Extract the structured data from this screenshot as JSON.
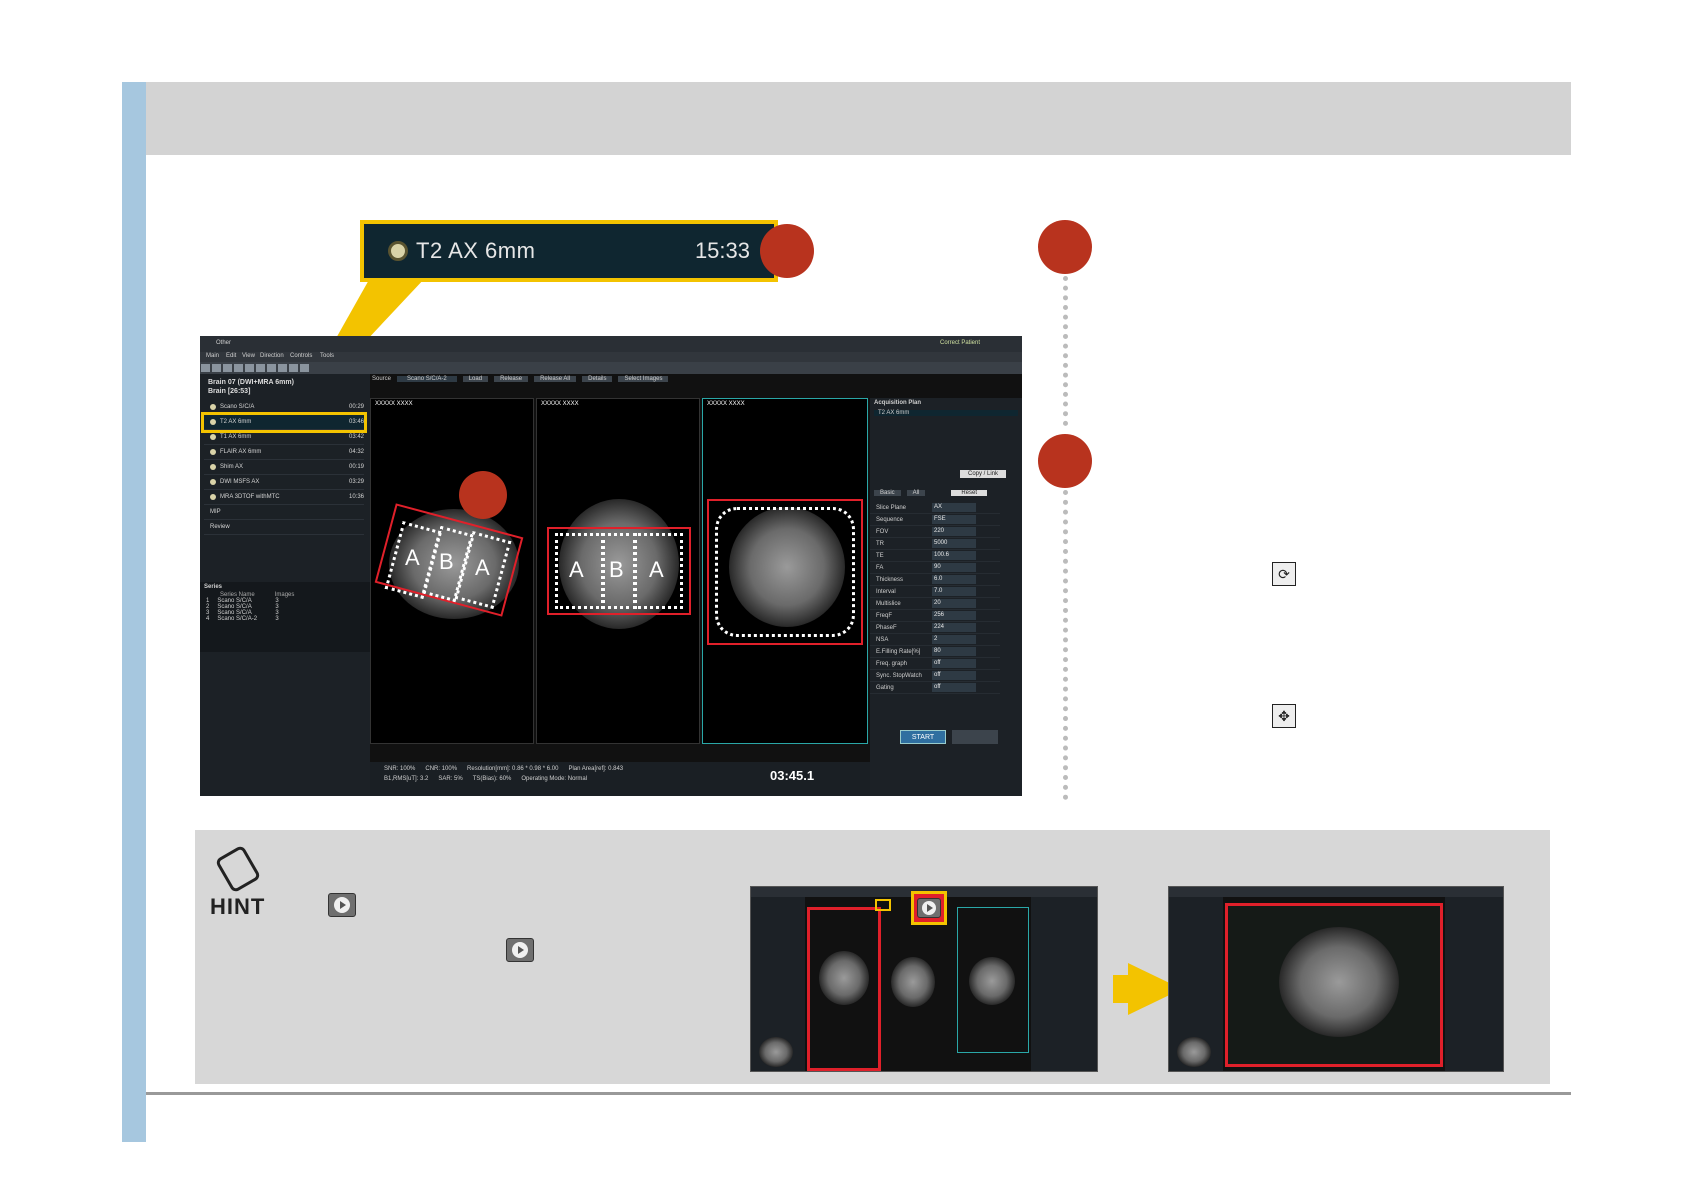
{
  "callout": {
    "series_name": "T2 AX 6mm",
    "series_time": "15:33"
  },
  "app": {
    "menubar_left": "Other",
    "patient_check": "Correct Patient",
    "menus": [
      "Main",
      "Edit",
      "View",
      "Direction",
      "Controls",
      "Tools"
    ],
    "protocol_title": "Brain 07 (DWI+MRA 6mm)",
    "protocol_sub": "Brain [26:53]",
    "protocol_items": [
      {
        "name": "Scano S/C/A",
        "time": "00:29"
      },
      {
        "name": "T2 AX 6mm",
        "time": "03:46"
      },
      {
        "name": "T1 AX 6mm",
        "time": "03:42"
      },
      {
        "name": "FLAIR AX 6mm",
        "time": "04:32"
      },
      {
        "name": "Shim AX",
        "time": "00:19"
      },
      {
        "name": "DWI MSFS AX",
        "time": "03:29"
      },
      {
        "name": "MRA 3DTOF withMTC",
        "time": "10:36"
      },
      {
        "name": "MIP",
        "time": ""
      },
      {
        "name": "Review",
        "time": ""
      }
    ],
    "series_header": "Series",
    "series_cols": [
      "Series Name",
      "Images"
    ],
    "series_rows": [
      {
        "no": "1",
        "name": "Scano S/C/A",
        "images": "3"
      },
      {
        "no": "2",
        "name": "Scano S/C/A",
        "images": "3"
      },
      {
        "no": "3",
        "name": "Scano S/C/A",
        "images": "3"
      },
      {
        "no": "4",
        "name": "Scano S/C/A-2",
        "images": "3"
      }
    ],
    "source_label": "Source",
    "source_value": "Scano S/C/A-2",
    "viewer_buttons": [
      "Load",
      "Release",
      "Release All",
      "Details",
      "Select Images"
    ],
    "viewer_patient": "XXXXX XXXX",
    "acq_title": "Acquisition Plan",
    "acq_item": "T2 AX 6mm",
    "copy_link": "Copy / Link",
    "basic_tab": "Basic",
    "all_tab": "All",
    "reset": "Reset",
    "params": [
      {
        "label": "Slice Plane",
        "value": "AX"
      },
      {
        "label": "Sequence",
        "value": "FSE"
      },
      {
        "label": "FOV",
        "value": "220"
      },
      {
        "label": "TR",
        "value": "5000"
      },
      {
        "label": "TE",
        "value": "100.6"
      },
      {
        "label": "FA",
        "value": "90"
      },
      {
        "label": "Thickness",
        "value": "6.0"
      },
      {
        "label": "Interval",
        "value": "7.0"
      },
      {
        "label": "Multislice",
        "value": "20"
      },
      {
        "label": "FreqF",
        "value": "256"
      },
      {
        "label": "PhaseF",
        "value": "224"
      },
      {
        "label": "NSA",
        "value": "2"
      },
      {
        "label": "E.Filling Rate[%]",
        "value": "80"
      },
      {
        "label": "Freq. graph",
        "value": "off"
      },
      {
        "label": "Sync. StopWatch",
        "value": "off"
      },
      {
        "label": "Gating",
        "value": "off"
      }
    ],
    "start": "START",
    "timer": "03:45.1",
    "status": [
      "SNR: 100%",
      "CNR: 100%",
      "Resolution[mm]: 0.86 * 0.98 * 6.00",
      "Plan Area[ref]: 0.843",
      "B1,RMS[uT]: 3.2",
      "SAR: 5%",
      "TS(Bias): 60%",
      "Operating Mode: Normal"
    ],
    "labels_sagittal": [
      "A",
      "B",
      "A"
    ],
    "labels_coronal": [
      "A",
      "B",
      "A"
    ]
  },
  "hint": {
    "label": "HINT"
  },
  "colors": {
    "accent_yellow": "#f3c300",
    "marker_red": "#b8331e",
    "frame_red": "#e0202a",
    "sidebar_blue": "#a6c7df"
  },
  "icons": [
    "rotate-icon",
    "move-icon",
    "play-icon",
    "hint-pencil-icon"
  ]
}
